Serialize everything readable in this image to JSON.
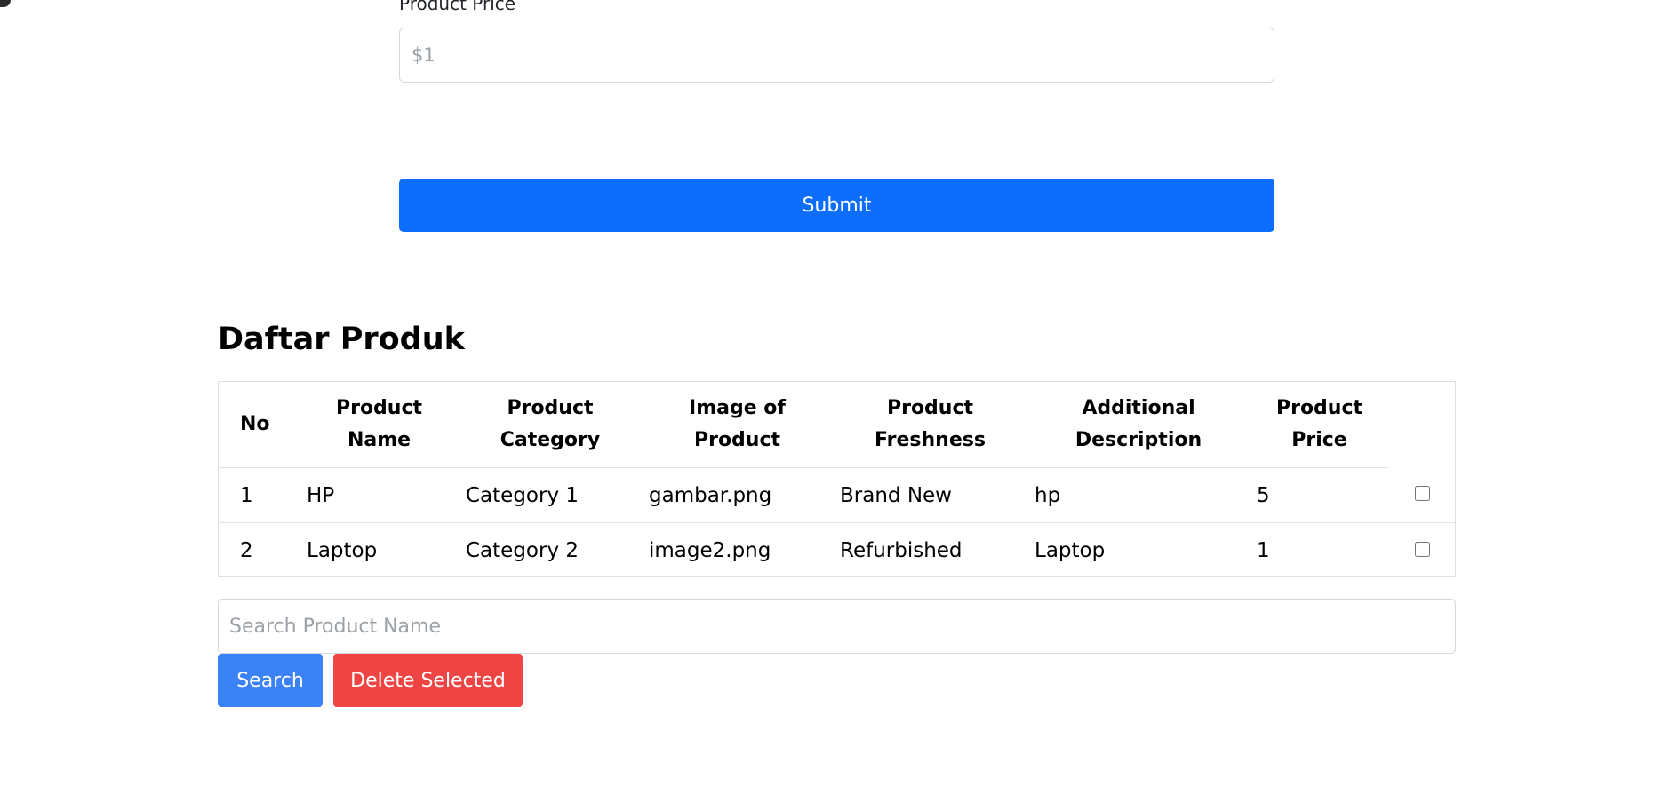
{
  "form": {
    "price_label": "Product Price",
    "price_placeholder": "$1",
    "submit_label": "Submit"
  },
  "product_list": {
    "title": "Daftar Produk",
    "headers": [
      "No",
      "Product Name",
      "Product Category",
      "Image of Product",
      "Product Freshness",
      "Additional Description",
      "Product Price"
    ],
    "rows": [
      {
        "no": "1",
        "name": "HP",
        "category": "Category 1",
        "image": "gambar.png",
        "freshness": "Brand New",
        "description": "hp",
        "price": "5",
        "checked": false
      },
      {
        "no": "2",
        "name": "Laptop",
        "category": "Category 2",
        "image": "image2.png",
        "freshness": "Refurbished",
        "description": "Laptop",
        "price": "1",
        "checked": false
      }
    ]
  },
  "search": {
    "placeholder": "Search Product Name",
    "search_label": "Search",
    "delete_label": "Delete Selected"
  },
  "colors": {
    "primary": "#0d6efd",
    "search_button": "#3b82f6",
    "delete_button": "#ef4444",
    "border": "#dcdfe2"
  }
}
